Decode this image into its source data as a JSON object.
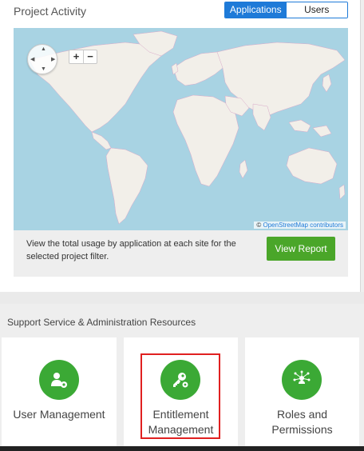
{
  "header": {
    "title": "Project Activity",
    "toggle": {
      "applications_label": "Applications",
      "users_label": "Users",
      "active": "Applications"
    }
  },
  "map": {
    "attribution_prefix": "©",
    "attribution_link": "OpenStreetMap contributors",
    "zoom_in_label": "+",
    "zoom_out_label": "−"
  },
  "info": {
    "text": "View the total usage by application at each site for the selected project filter.",
    "button_label": "View Report"
  },
  "support": {
    "title": "Support Service & Administration Resources",
    "cards": [
      {
        "label": "User Management",
        "icon": "user-gear-icon"
      },
      {
        "label": "Entitlement Management",
        "icon": "key-gear-icon"
      },
      {
        "label": "Roles and Permissions",
        "icon": "network-people-icon"
      }
    ]
  },
  "colors": {
    "accent_blue": "#1e7ad8",
    "button_green": "#4aa629",
    "icon_green": "#3ba935",
    "highlight_red": "#e02020",
    "ocean": "#a8d3e3",
    "land": "#f2efe9"
  }
}
